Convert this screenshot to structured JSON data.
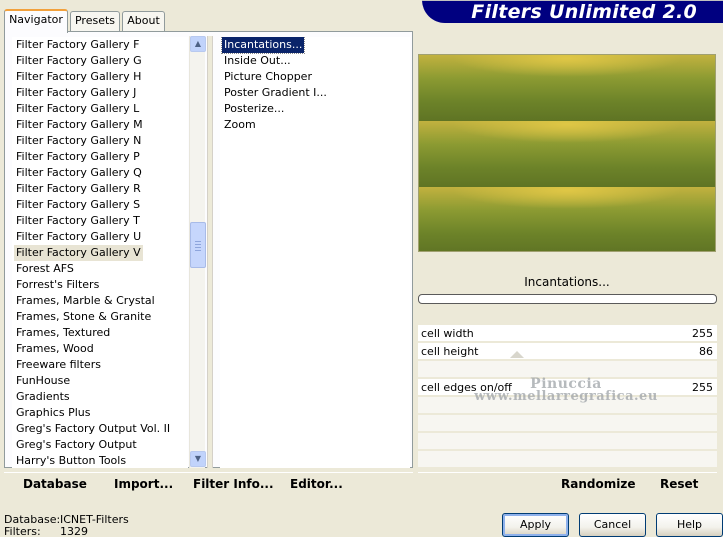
{
  "header": {
    "title": "Filters Unlimited 2.0"
  },
  "tabs": [
    {
      "label": "Navigator",
      "active": true
    },
    {
      "label": "Presets",
      "active": false
    },
    {
      "label": "About",
      "active": false
    }
  ],
  "categories": {
    "items": [
      "Filter Factory Gallery F",
      "Filter Factory Gallery G",
      "Filter Factory Gallery H",
      "Filter Factory Gallery J",
      "Filter Factory Gallery L",
      "Filter Factory Gallery M",
      "Filter Factory Gallery N",
      "Filter Factory Gallery P",
      "Filter Factory Gallery Q",
      "Filter Factory Gallery R",
      "Filter Factory Gallery S",
      "Filter Factory Gallery T",
      "Filter Factory Gallery U",
      "Filter Factory Gallery V",
      "Forest AFS",
      "Forrest's Filters",
      "Frames, Marble & Crystal",
      "Frames, Stone & Granite",
      "Frames, Textured",
      "Frames, Wood",
      "Freeware filters",
      "FunHouse",
      "Gradients",
      "Graphics Plus",
      "Greg's Factory Output Vol. II",
      "Greg's Factory Output",
      "Harry's Button Tools"
    ],
    "selected_index": 13
  },
  "filters": {
    "items": [
      "Incantations...",
      "Inside Out...",
      "Picture Chopper",
      "Poster Gradient I...",
      "Posterize...",
      "Zoom"
    ],
    "selected_index": 0
  },
  "preview": {
    "filter_name": "Incantations...",
    "progress": 0
  },
  "params": [
    {
      "label": "cell width",
      "value": "255"
    },
    {
      "label": "cell height",
      "value": "86"
    },
    {
      "label": "cell edges on/off",
      "value": "255"
    }
  ],
  "watermark": {
    "line1": "Pinuccia",
    "line2": "www.mellarregrafica.eu"
  },
  "left_actions": {
    "database": "Database",
    "import": "Import...",
    "filter_info": "Filter Info...",
    "editor": "Editor..."
  },
  "right_actions": {
    "randomize": "Randomize",
    "reset": "Reset"
  },
  "status": {
    "database_label": "Database:",
    "database_value": "ICNET-Filters",
    "filters_label": "Filters:",
    "filters_value": "1329"
  },
  "buttons": {
    "apply": "Apply",
    "cancel": "Cancel",
    "help": "Help"
  },
  "colors": {
    "banner": "#000080",
    "selection": "#0a246a",
    "preview_gold": "#c2b23f",
    "preview_olive": "#6d8329"
  }
}
